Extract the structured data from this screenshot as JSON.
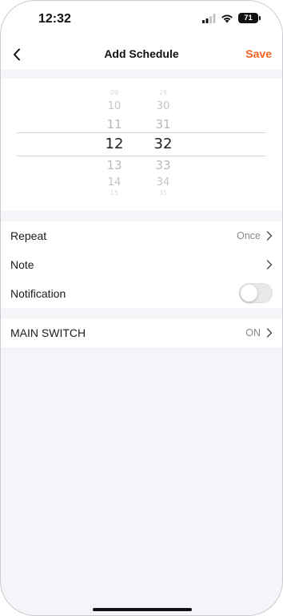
{
  "status_bar": {
    "time": "12:32",
    "battery": "71"
  },
  "nav": {
    "title": "Add Schedule",
    "save_label": "Save",
    "back_icon": "chevron-left-icon"
  },
  "picker": {
    "hours": [
      "09",
      "10",
      "11",
      "12",
      "13",
      "14",
      "15"
    ],
    "minutes": [
      "29",
      "30",
      "31",
      "32",
      "33",
      "34",
      "35"
    ],
    "selected_hour": "12",
    "selected_minute": "32"
  },
  "settings": {
    "repeat": {
      "label": "Repeat",
      "value": "Once"
    },
    "note": {
      "label": "Note"
    },
    "notification": {
      "label": "Notification",
      "enabled": false
    }
  },
  "device": {
    "label": "MAIN SWITCH",
    "value": "ON"
  },
  "colors": {
    "accent": "#f26322",
    "background": "#f4f5f9",
    "card": "#ffffff"
  }
}
